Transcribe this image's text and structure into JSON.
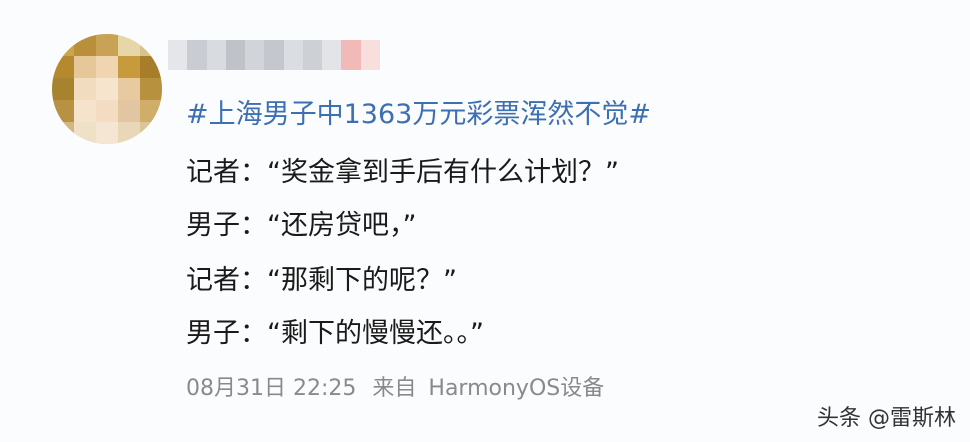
{
  "post": {
    "hashtag": "#上海男子中1363万元彩票浑然不觉#",
    "dialogue": [
      {
        "speaker": "记者：",
        "text": "“奖金拿到手后有什么计划？”"
      },
      {
        "speaker": "男子：",
        "text": "“还房贷吧，”"
      },
      {
        "speaker": "记者：",
        "text": "“那剩下的呢？”"
      },
      {
        "speaker": "男子：",
        "text": "“剩下的慢慢还。。”"
      }
    ],
    "timestamp": "08月31日 22:25",
    "source_prefix": "来自",
    "device": "HarmonyOS设备"
  },
  "watermark": "头条 @雷斯林",
  "colors": {
    "hashtag": "#3d6fb3",
    "text": "#1a1a1a",
    "meta": "#8a8a8a"
  }
}
